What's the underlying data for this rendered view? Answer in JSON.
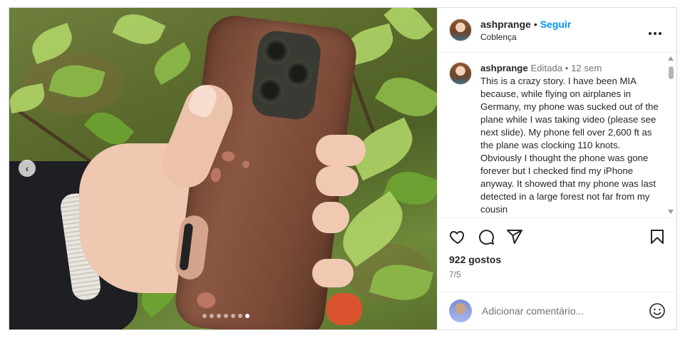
{
  "post": {
    "author": {
      "username": "ashprange",
      "follow_label": "Seguir",
      "separator": "•",
      "location": "Coblença"
    },
    "more_icon": "more-horizontal-icon",
    "media": {
      "current_slide": 7,
      "total_slides": 7
    },
    "caption": {
      "username": "ashprange",
      "edited_label": "Editada",
      "separator": "•",
      "age": "12 sem",
      "text": "This is a crazy story. I have been MIA because, while flying on airplanes in Germany, my phone was sucked out of the plane while I was taking video (please see next slide). My phone fell over 2,600 ft as the plane was clocking 110 knots. Obviously I thought the phone was gone forever but I checked find my iPhone anyway. It showed that my phone was last detected in a large forest not far from my cousin"
    },
    "actions": {
      "like_icon": "heart-icon",
      "comment_icon": "comment-icon",
      "share_icon": "share-icon",
      "save_icon": "bookmark-icon"
    },
    "likes": "922 gostos",
    "slide_indicator": "7/5",
    "add_comment": {
      "placeholder": "Adicionar comentário...",
      "emoji_icon": "emoji-icon"
    },
    "colors": {
      "follow": "#0095f6",
      "text": "#262626",
      "muted": "#737373",
      "border": "#dbdbdb"
    }
  }
}
